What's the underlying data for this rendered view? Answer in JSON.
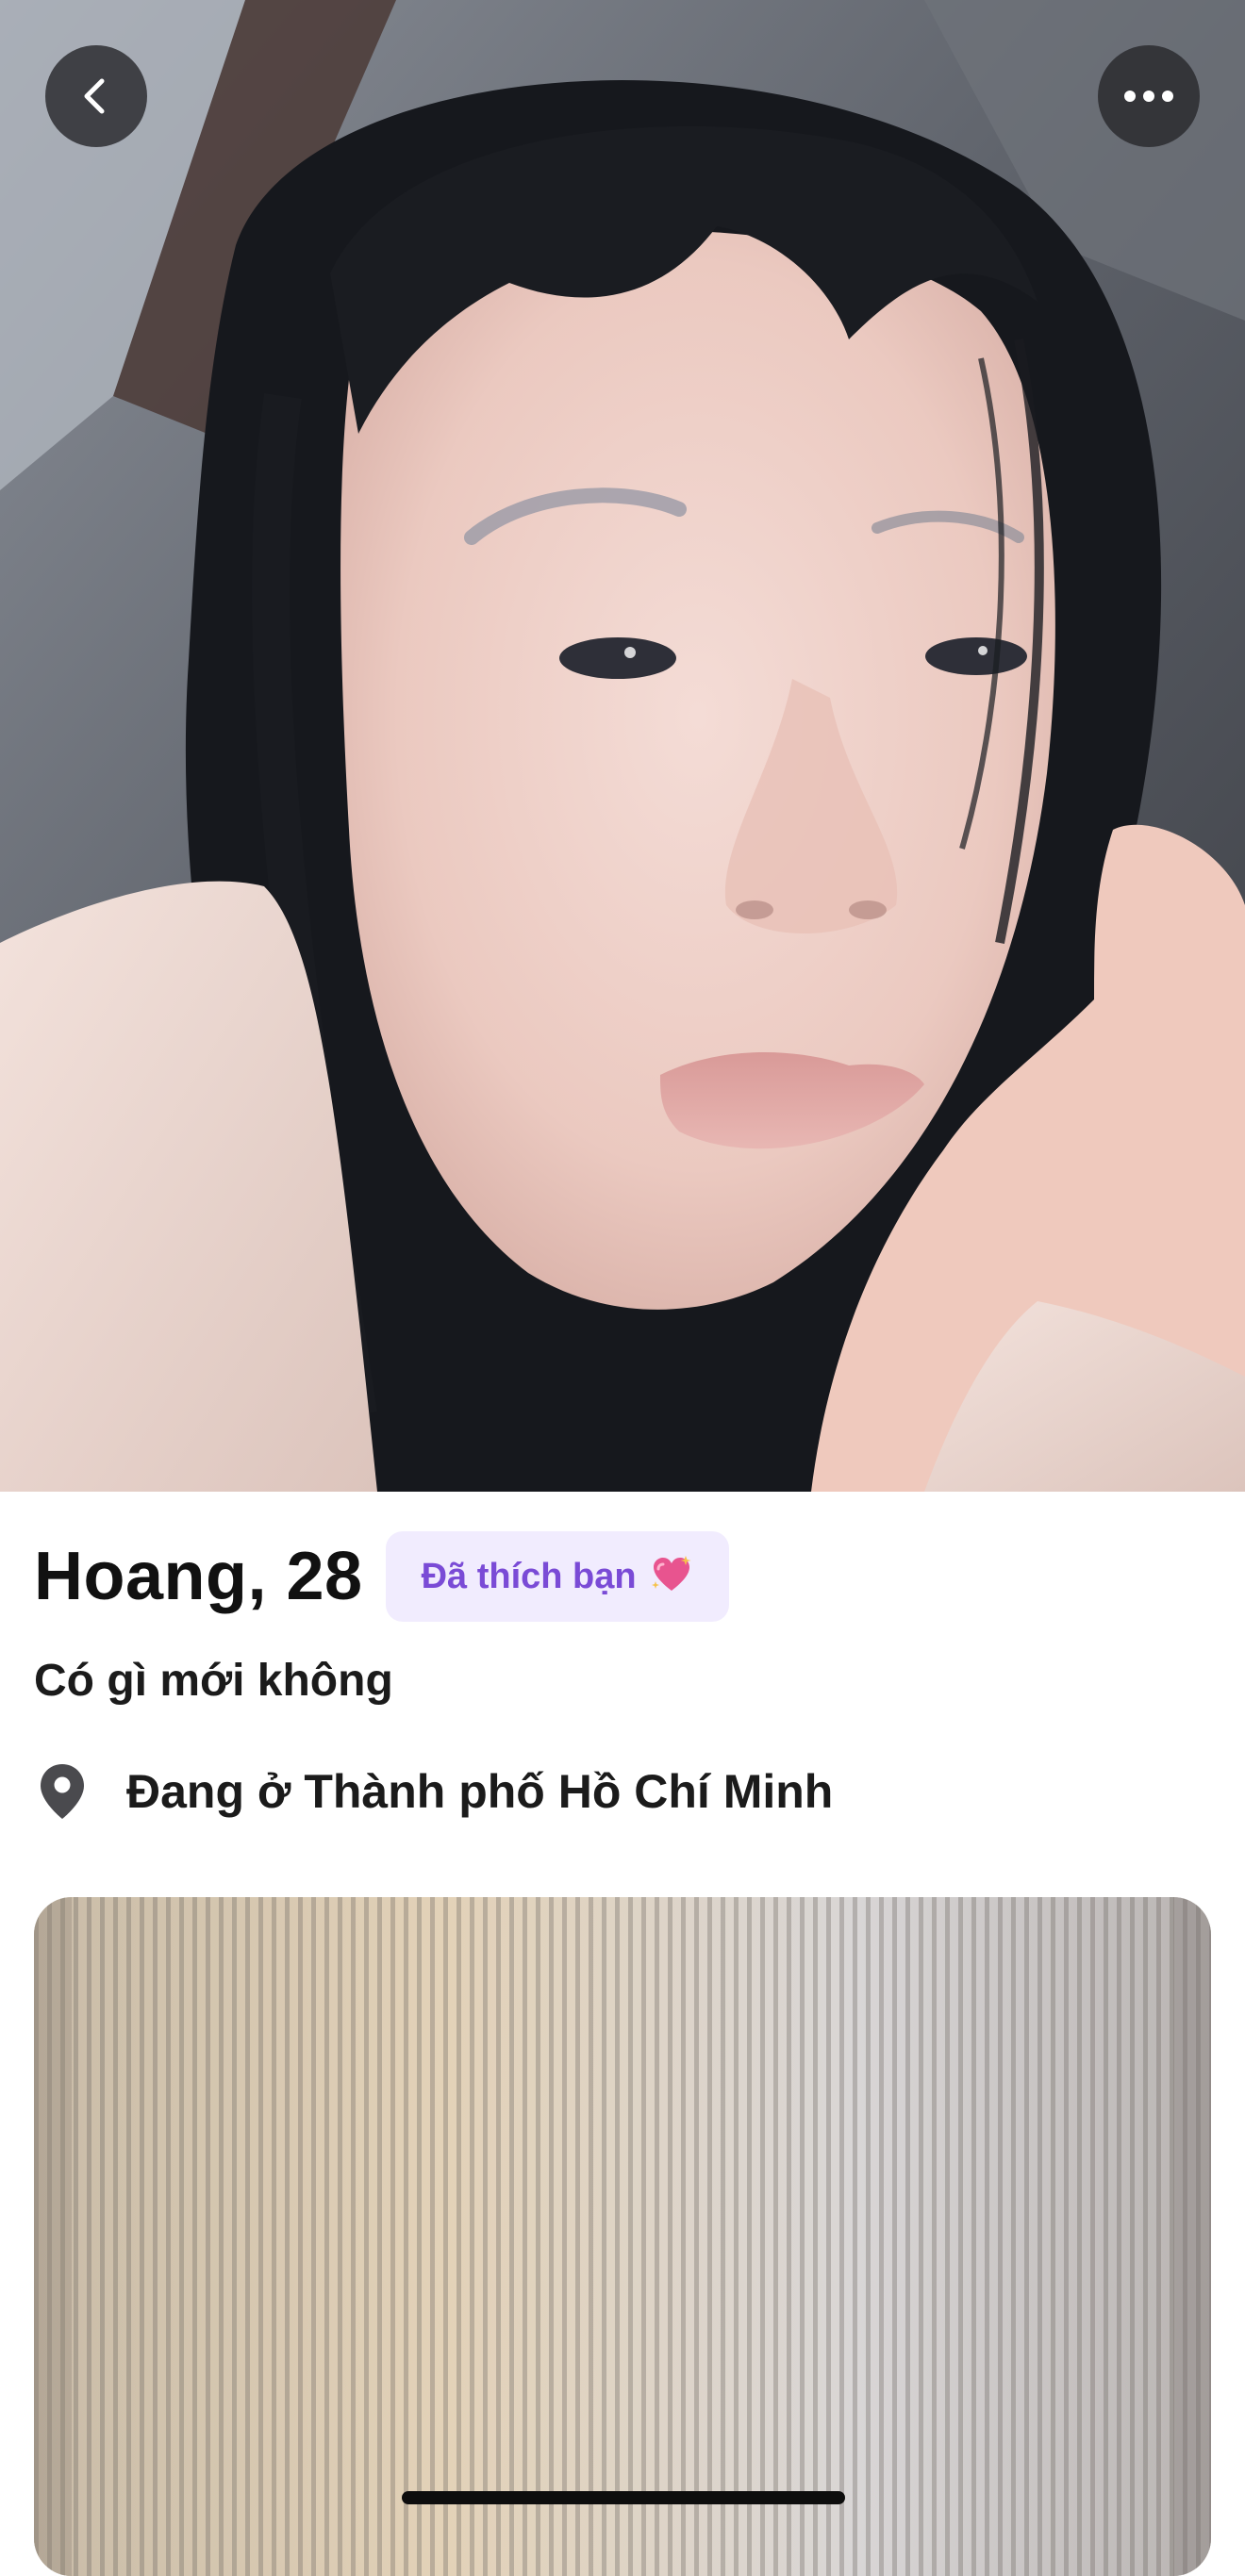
{
  "profile": {
    "name_age": "Hoang, 28",
    "liked_badge": "Đã thích bạn",
    "liked_badge_emoji": "heart-with-sparkles-icon",
    "status": "Có gì mới không",
    "location": "Đang ở Thành phố Hồ Chí Minh"
  },
  "colors": {
    "badge_bg": "#f1ecfe",
    "badge_text": "#7a4bd6",
    "text_primary": "#111111",
    "button_bg": "#28282c"
  },
  "icons": {
    "back": "chevron-left-icon",
    "more": "ellipsis-icon",
    "location": "map-pin-icon"
  }
}
